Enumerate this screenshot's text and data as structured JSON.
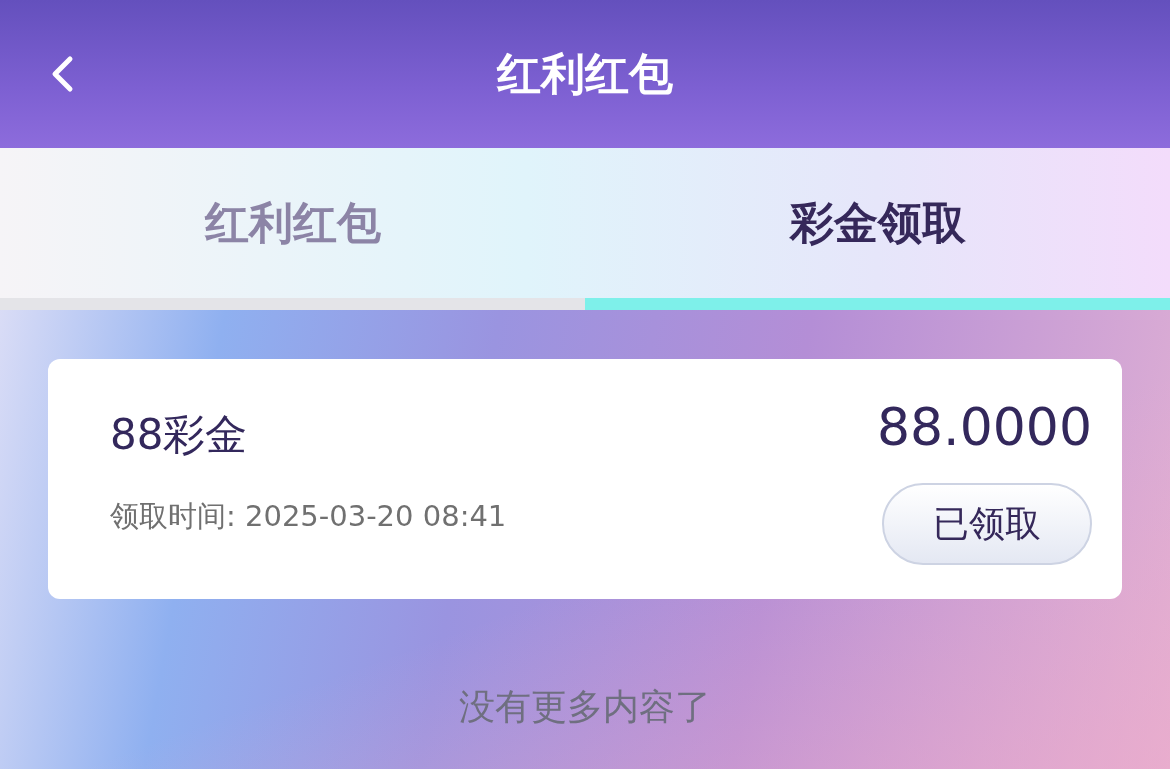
{
  "header": {
    "title": "红利红包"
  },
  "tabs": [
    {
      "label": "红利红包",
      "selected": false
    },
    {
      "label": "彩金领取",
      "selected": true
    }
  ],
  "records": [
    {
      "title": "88彩金",
      "amount": "88.0000",
      "time_label": "领取时间: 2025-03-20 08:41",
      "status": "已领取",
      "claimed": true
    }
  ],
  "footer": "没有更多内容了"
}
